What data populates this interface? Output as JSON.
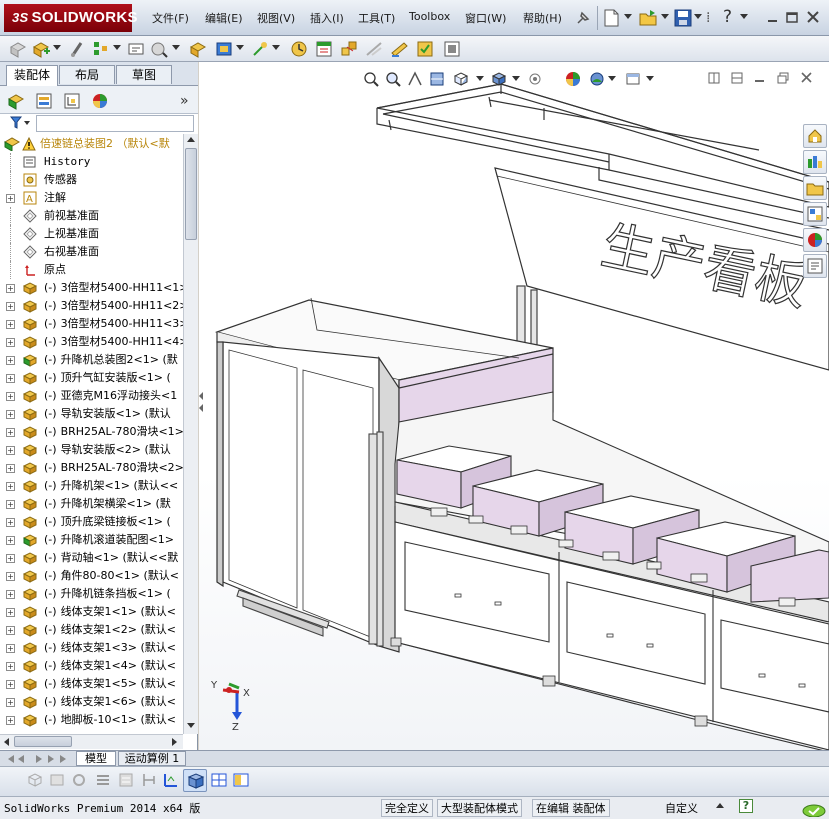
{
  "app": {
    "logo_text": "SOLIDWORKS",
    "logo_prefix": "3S"
  },
  "menu": [
    {
      "label": "文件(F)"
    },
    {
      "label": "编辑(E)"
    },
    {
      "label": "视图(V)"
    },
    {
      "label": "插入(I)"
    },
    {
      "label": "工具(T)"
    },
    {
      "label": "Toolbox"
    },
    {
      "label": "窗口(W)"
    },
    {
      "label": "帮助(H)"
    }
  ],
  "panel": {
    "tabs": [
      {
        "label": "装配体"
      },
      {
        "label": "布局"
      },
      {
        "label": "草图"
      }
    ],
    "expand_chevron": "»"
  },
  "tree": {
    "root": "倍速链总装图2 （默认<默",
    "items": [
      {
        "label": "History",
        "mono": true
      },
      {
        "label": "传感器"
      },
      {
        "label": "注解",
        "expandable": true
      },
      {
        "label": "前视基准面"
      },
      {
        "label": "上视基准面"
      },
      {
        "label": "右视基准面"
      },
      {
        "label": "原点"
      },
      {
        "prefix": "(-)",
        "label": "3倍型材5400-HH11<1>",
        "expandable": true
      },
      {
        "prefix": "(-)",
        "label": "3倍型材5400-HH11<2>",
        "expandable": true
      },
      {
        "prefix": "(-)",
        "label": "3倍型材5400-HH11<3>",
        "expandable": true
      },
      {
        "prefix": "(-)",
        "label": "3倍型材5400-HH11<4>",
        "expandable": true
      },
      {
        "prefix": "(-)",
        "label": "升降机总装图2<1> (默",
        "expandable": true
      },
      {
        "prefix": "(-)",
        "label": "顶升气缸安装版<1> (",
        "expandable": true
      },
      {
        "prefix": "(-)",
        "label": "亚德克M16浮动接头<1",
        "expandable": true
      },
      {
        "prefix": "(-)",
        "label": "导轨安装版<1> (默认",
        "expandable": true
      },
      {
        "prefix": "(-)",
        "label": "BRH25AL-780滑块<1>",
        "expandable": true
      },
      {
        "prefix": "(-)",
        "label": "导轨安装版<2> (默认",
        "expandable": true
      },
      {
        "prefix": "(-)",
        "label": "BRH25AL-780滑块<2>",
        "expandable": true
      },
      {
        "prefix": "(-)",
        "label": "升降机架<1> (默认<<",
        "expandable": true
      },
      {
        "prefix": "(-)",
        "label": "升降机架横梁<1> (默",
        "expandable": true
      },
      {
        "prefix": "(-)",
        "label": "顶升底梁链接板<1> (",
        "expandable": true
      },
      {
        "prefix": "(-)",
        "label": "升降机滚道装配图<1>",
        "expandable": true
      },
      {
        "prefix": "(-)",
        "label": "背动轴<1> (默认<<默",
        "expandable": true
      },
      {
        "prefix": "(-)",
        "label": "角件80-80<1> (默认<",
        "expandable": true
      },
      {
        "prefix": "(-)",
        "label": "升降机链条挡板<1> (",
        "expandable": true
      },
      {
        "prefix": "(-)",
        "label": "线体支架1<1> (默认<",
        "expandable": true
      },
      {
        "prefix": "(-)",
        "label": "线体支架1<2> (默认<",
        "expandable": true
      },
      {
        "prefix": "(-)",
        "label": "线体支架1<3> (默认<",
        "expandable": true
      },
      {
        "prefix": "(-)",
        "label": "线体支架1<4> (默认<",
        "expandable": true
      },
      {
        "prefix": "(-)",
        "label": "线体支架1<5> (默认<",
        "expandable": true
      },
      {
        "prefix": "(-)",
        "label": "线体支架1<6> (默认<",
        "expandable": true
      },
      {
        "prefix": "(-)",
        "label": "地脚板-10<1> (默认<",
        "expandable": true
      }
    ]
  },
  "model_text": "生产看板",
  "triad": {
    "y": "Y",
    "x": "X",
    "z": "Z"
  },
  "bottom_tabs": [
    {
      "label": "模型"
    },
    {
      "label": "运动算例 1"
    }
  ],
  "status": {
    "product": "SolidWorks Premium 2014 x64 版",
    "fully_defined": "完全定义",
    "large_assembly": "大型装配体模式",
    "editing": "在编辑 装配体",
    "custom": "自定义",
    "help_icon_text": "?"
  },
  "colors": {
    "accent_red": "#a80a14",
    "box_fill": "#e6d6ea",
    "frame_grey": "#7c7c7c"
  }
}
